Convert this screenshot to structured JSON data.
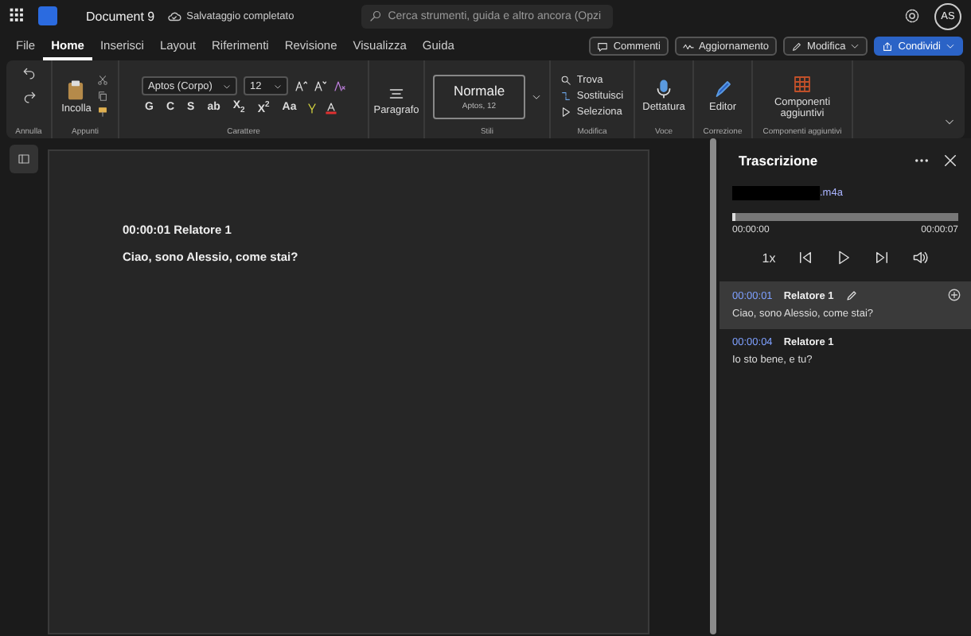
{
  "app_bar": {
    "document_title": "Document 9",
    "save_status": "Salvataggio completato",
    "search": {
      "placeholder": "Cerca strumenti, guida e altro ancora (Opzi"
    },
    "avatar": "AS"
  },
  "menu_tabs": [
    {
      "label": "File",
      "selected": false
    },
    {
      "label": "Home",
      "selected": true
    },
    {
      "label": "Inserisci",
      "selected": false
    },
    {
      "label": "Layout",
      "selected": false
    },
    {
      "label": "Riferimenti",
      "selected": false
    },
    {
      "label": "Revisione",
      "selected": false
    },
    {
      "label": "Visualizza",
      "selected": false
    },
    {
      "label": "Guida",
      "selected": false
    }
  ],
  "actions": [
    {
      "label": "Commenti",
      "kind": "comment"
    },
    {
      "label": "Aggiornamento",
      "kind": "activity"
    },
    {
      "label": "Modifica",
      "kind": "edit"
    },
    {
      "label": "Condividi",
      "kind": "share"
    }
  ],
  "ribbon": {
    "undo": {
      "label": "Annulla"
    },
    "clipboard": {
      "paste": "Incolla",
      "label": "Appunti"
    },
    "font": {
      "name": "Aptos (Corpo)",
      "size": "12",
      "format_buttons": [
        "G",
        "C",
        "S",
        "ab",
        "X$_{2}$",
        "X$^{2}$",
        "Aa"
      ],
      "label": "Carattere"
    },
    "paragraph": {
      "button": "Paragrafo"
    },
    "styles": {
      "style_name": "Normale",
      "style_font": "Aptos, 12",
      "label": "Stili"
    },
    "editing": {
      "items": [
        "Trova",
        "Sostituisci",
        "Seleziona"
      ],
      "label": "Modifica"
    },
    "voice": {
      "button": "Dettatura",
      "label": "Voce"
    },
    "proofing": {
      "button": "Editor",
      "label": "Correzione"
    },
    "addins": {
      "button": "Componenti aggiuntivi",
      "label": "Componenti aggiuntivi"
    }
  },
  "document": {
    "lines": [
      "00:00:01 Relatore 1",
      "Ciao, sono Alessio, come stai?"
    ]
  },
  "transcript": {
    "title": "Trascrizione",
    "file_name": ".m4a",
    "level": 0,
    "elapsed": "00:00:00",
    "total": "00:00:07",
    "speed": "1x",
    "entries": [
      {
        "time": "00:00:01",
        "speaker": "Relatore 1",
        "text": "Ciao, sono Alessio, come stai?",
        "selected": true
      },
      {
        "time": "00:00:04",
        "speaker": "Relatore 1",
        "text": "Io sto bene, e tu?",
        "selected": false
      }
    ]
  }
}
